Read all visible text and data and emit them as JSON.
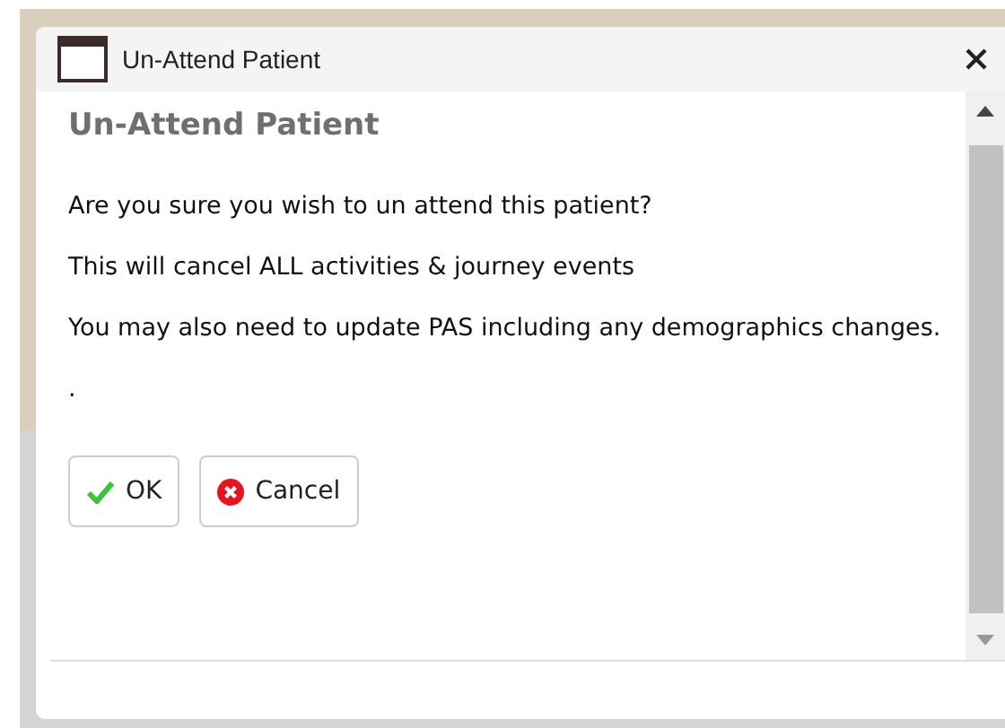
{
  "window": {
    "title": "Un-Attend Patient"
  },
  "heading": "Un-Attend Patient",
  "messages": [
    "Are you sure you wish to un attend this patient?",
    "This will cancel ALL activities & journey events",
    "You may also need to update PAS including any demographics changes.",
    "."
  ],
  "buttons": [
    {
      "kind": "ok",
      "label": "OK"
    },
    {
      "kind": "cancel",
      "label": "Cancel"
    }
  ]
}
